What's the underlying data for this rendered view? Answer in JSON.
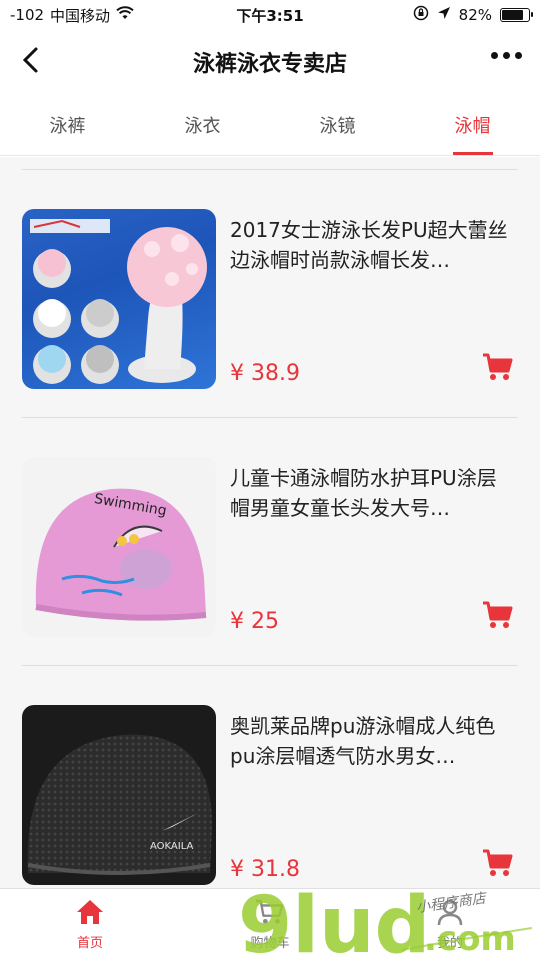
{
  "status_bar": {
    "signal": "-102",
    "carrier": "中国移动",
    "time": "下午3:51",
    "battery": "82%",
    "battery_level": 0.82
  },
  "nav": {
    "title": "泳裤泳衣专卖店",
    "back_icon": "chevron-left-icon",
    "more_icon": "more-dots-icon"
  },
  "tabs": [
    {
      "label": "泳裤",
      "active": false
    },
    {
      "label": "泳衣",
      "active": false
    },
    {
      "label": "泳镜",
      "active": false
    },
    {
      "label": "泳帽",
      "active": true
    }
  ],
  "products": [
    {
      "title": "2017女士游泳长发PU超大蕾丝边泳帽时尚款泳帽长发…",
      "price": "¥ 38.9"
    },
    {
      "title": "儿童卡通泳帽防水护耳PU涂层帽男童女童长头发大号…",
      "price": "¥ 25",
      "image_label": "粉色",
      "cap_text": "Swimming"
    },
    {
      "title": "奥凯莱品牌pu游泳帽成人纯色pu涂层帽透气防水男女…",
      "price": "¥ 31.8",
      "cap_text": "AOKAILA"
    }
  ],
  "tab_bar": [
    {
      "label": "首页",
      "icon": "home-icon",
      "active": true
    },
    {
      "label": "购物车",
      "icon": "cart-icon",
      "active": false
    },
    {
      "label": "我的",
      "icon": "user-icon",
      "active": false
    }
  ],
  "watermark": {
    "text": "9lud",
    "domain": ".com",
    "tagline": "小程序商店"
  },
  "colors": {
    "accent": "#e8343b",
    "background": "#f6f6f6"
  }
}
